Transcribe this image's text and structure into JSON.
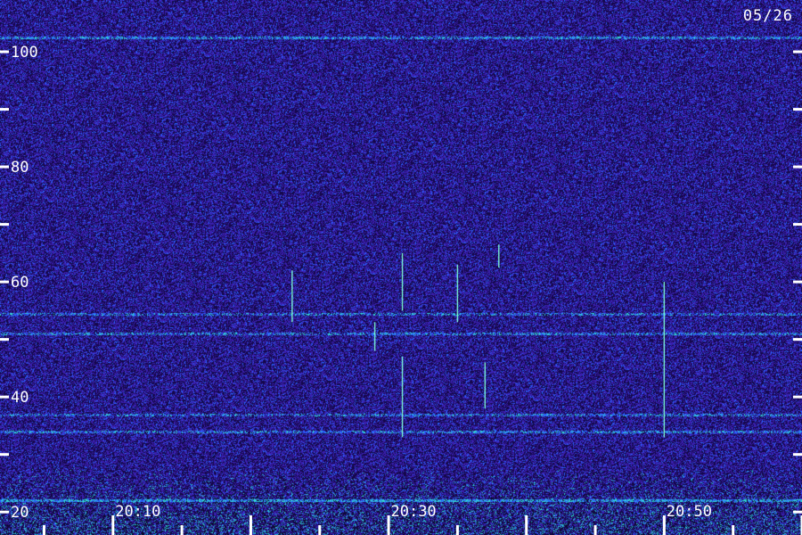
{
  "chart_data": {
    "type": "heatmap",
    "title": "",
    "date_label": "05/26",
    "xlabel": "",
    "ylabel": "",
    "ylim": [
      16,
      109
    ],
    "xlim": [
      20.03,
      21.0
    ],
    "y_ticks": [
      20,
      30,
      40,
      50,
      60,
      70,
      80,
      90,
      100
    ],
    "y_tick_labels": [
      "20",
      "40",
      "60",
      "80",
      "100"
    ],
    "y_tick_label_values": [
      20,
      40,
      60,
      80,
      100
    ],
    "x_ticks_major": [
      "20:10",
      "20:20",
      "20:30",
      "20:40",
      "20:50",
      "21:00"
    ],
    "x_tick_labels": [
      "20:10",
      "20:30",
      "20:50"
    ],
    "x_tick_label_values": [
      "20:10",
      "20:30",
      "20:50"
    ],
    "colors": {
      "background": "#1a0c5a",
      "noise_low": "#14084a",
      "noise_mid": "#3a20b0",
      "noise_high": "#2a60ff",
      "band_strong": "#33d6d6",
      "meteor_streak": "#7fffd4",
      "text": "#ffffff"
    },
    "horizontal_bands": [
      {
        "y": 102.5,
        "strength": 0.6
      },
      {
        "y": 54.5,
        "strength": 0.45
      },
      {
        "y": 51.0,
        "strength": 0.5
      },
      {
        "y": 37.0,
        "strength": 0.45
      },
      {
        "y": 34.0,
        "strength": 0.55
      },
      {
        "y": 22.0,
        "strength": 0.9
      }
    ],
    "meteor_streaks": [
      {
        "t": "20:23",
        "y_from": 53.0,
        "y_to": 62.0
      },
      {
        "t": "20:31",
        "y_from": 55.0,
        "y_to": 65.0
      },
      {
        "t": "20:31",
        "y_from": 33.0,
        "y_to": 47.0
      },
      {
        "t": "20:29",
        "y_from": 48.0,
        "y_to": 53.0
      },
      {
        "t": "20:35",
        "y_from": 53.0,
        "y_to": 63.0
      },
      {
        "t": "20:37",
        "y_from": 38.0,
        "y_to": 46.0
      },
      {
        "t": "20:38",
        "y_from": 62.5,
        "y_to": 66.5
      },
      {
        "t": "20:50",
        "y_from": 33.0,
        "y_to": 60.0
      }
    ]
  }
}
